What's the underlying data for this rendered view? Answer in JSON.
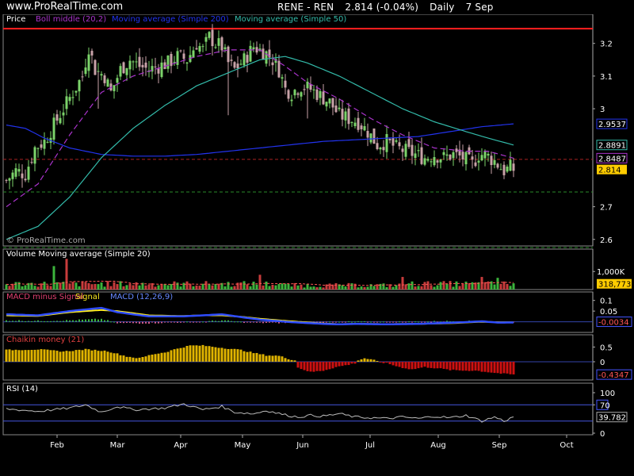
{
  "header": {
    "brand": "www.ProRealTime.com",
    "symbol": "RENE - REN",
    "last_change": "2.814 (-0.04%)",
    "period": "Daily",
    "date": "7 Sep"
  },
  "colors": {
    "up": "#7bd36a",
    "down": "#c8a2a8",
    "boll": "#aa33cc",
    "ma200": "#2233ee",
    "ma50": "#33bbaa",
    "resistance": "#ff2020",
    "support": "#2a8a2a",
    "volume_up": "#3cb43c",
    "volume_down": "#c83c3c",
    "vol_ma": "#ff5555",
    "macd": "#2e4cff",
    "signal": "#ffee22",
    "chaikin_pos": "#e0b400",
    "chaikin_neg": "#cc1111",
    "rsi": "#bbbbbb",
    "rsi_bands": "#4455dd",
    "last_price_bg": "#ffcc00"
  },
  "chart_data": [
    {
      "type": "candlestick",
      "title": "Price",
      "legend": [
        "Boll middle (20,2)",
        "Moving average (Simple 200)",
        "Moving average (Simple 50)"
      ],
      "y_ticks": [
        "3.2",
        "3.1",
        "3",
        "2.7",
        "2.6"
      ],
      "ylim": [
        2.58,
        3.26
      ],
      "watermark": "© ProRealTime.com",
      "x_months": [
        "Feb",
        "Mar",
        "Apr",
        "May",
        "Jun",
        "Jul",
        "Aug",
        "Sep",
        "Oct"
      ],
      "value_tags": [
        {
          "label": "2.9537",
          "value": 2.9537,
          "series": "ma200"
        },
        {
          "label": "2.8891",
          "value": 2.8891,
          "series": "ma50"
        },
        {
          "label": "2.8487",
          "value": 2.8487,
          "series": "boll"
        },
        {
          "label": "2.814",
          "value": 2.814,
          "series": "last"
        }
      ],
      "resistance": 3.245,
      "reference_levels": [
        2.845,
        2.745,
        2.575
      ],
      "close_anchors": [
        [
          0,
          2.78
        ],
        [
          3,
          2.81
        ],
        [
          6,
          2.8
        ],
        [
          9,
          2.88
        ],
        [
          12,
          2.9
        ],
        [
          15,
          2.95
        ],
        [
          18,
          3.0
        ],
        [
          21,
          3.05
        ],
        [
          24,
          3.1
        ],
        [
          26,
          3.19
        ],
        [
          28,
          3.12
        ],
        [
          31,
          3.1
        ],
        [
          33,
          3.05
        ],
        [
          36,
          3.12
        ],
        [
          39,
          3.15
        ],
        [
          42,
          3.13
        ],
        [
          45,
          3.12
        ],
        [
          48,
          3.13
        ],
        [
          51,
          3.14
        ],
        [
          54,
          3.16
        ],
        [
          57,
          3.15
        ],
        [
          60,
          3.2
        ],
        [
          62,
          3.18
        ],
        [
          64,
          3.22
        ],
        [
          66,
          3.2
        ],
        [
          68,
          3.19
        ],
        [
          70,
          3.14
        ],
        [
          72,
          3.12
        ],
        [
          75,
          3.15
        ],
        [
          78,
          3.19
        ],
        [
          80,
          3.18
        ],
        [
          82,
          3.17
        ],
        [
          84,
          3.15
        ],
        [
          86,
          3.12
        ],
        [
          88,
          3.06
        ],
        [
          90,
          3.05
        ],
        [
          93,
          3.07
        ],
        [
          96,
          3.06
        ],
        [
          99,
          3.04
        ],
        [
          102,
          3.02
        ],
        [
          105,
          2.98
        ],
        [
          108,
          2.97
        ],
        [
          111,
          2.96
        ],
        [
          114,
          2.93
        ],
        [
          117,
          2.89
        ],
        [
          120,
          2.9
        ],
        [
          123,
          2.88
        ],
        [
          126,
          2.87
        ],
        [
          129,
          2.86
        ],
        [
          132,
          2.85
        ],
        [
          135,
          2.86
        ],
        [
          138,
          2.85
        ],
        [
          141,
          2.86
        ],
        [
          144,
          2.85
        ],
        [
          147,
          2.83
        ],
        [
          149,
          2.86
        ],
        [
          151,
          2.86
        ],
        [
          154,
          2.84
        ],
        [
          157,
          2.81
        ],
        [
          159,
          2.82
        ],
        [
          160,
          2.814
        ]
      ],
      "ma50_anchors": [
        [
          0,
          2.6
        ],
        [
          10,
          2.64
        ],
        [
          20,
          2.73
        ],
        [
          30,
          2.85
        ],
        [
          40,
          2.94
        ],
        [
          50,
          3.01
        ],
        [
          60,
          3.07
        ],
        [
          70,
          3.11
        ],
        [
          80,
          3.15
        ],
        [
          88,
          3.16
        ],
        [
          95,
          3.14
        ],
        [
          105,
          3.1
        ],
        [
          115,
          3.05
        ],
        [
          125,
          3.0
        ],
        [
          135,
          2.96
        ],
        [
          145,
          2.93
        ],
        [
          152,
          2.91
        ],
        [
          160,
          2.889
        ]
      ],
      "ma200_anchors": [
        [
          0,
          2.95
        ],
        [
          6,
          2.94
        ],
        [
          12,
          2.91
        ],
        [
          20,
          2.88
        ],
        [
          30,
          2.86
        ],
        [
          40,
          2.855
        ],
        [
          50,
          2.855
        ],
        [
          60,
          2.86
        ],
        [
          70,
          2.87
        ],
        [
          80,
          2.88
        ],
        [
          90,
          2.89
        ],
        [
          100,
          2.9
        ],
        [
          110,
          2.905
        ],
        [
          120,
          2.91
        ],
        [
          130,
          2.915
        ],
        [
          140,
          2.93
        ],
        [
          150,
          2.945
        ],
        [
          160,
          2.9537
        ]
      ],
      "boll_anchors": [
        [
          0,
          2.7
        ],
        [
          10,
          2.77
        ],
        [
          20,
          2.92
        ],
        [
          30,
          3.05
        ],
        [
          40,
          3.1
        ],
        [
          50,
          3.13
        ],
        [
          60,
          3.16
        ],
        [
          70,
          3.18
        ],
        [
          80,
          3.18
        ],
        [
          88,
          3.13
        ],
        [
          95,
          3.08
        ],
        [
          105,
          3.03
        ],
        [
          115,
          2.97
        ],
        [
          125,
          2.92
        ],
        [
          135,
          2.88
        ],
        [
          145,
          2.87
        ],
        [
          152,
          2.87
        ],
        [
          160,
          2.8487
        ]
      ]
    },
    {
      "type": "bar",
      "title": "Volume Moving average (Simple 20)",
      "y_tick": "1,000K",
      "last_value_label": "318,773",
      "last_value": 318773,
      "spikes": [
        {
          "i": 15,
          "v": 1300000
        },
        {
          "i": 19,
          "v": 1700000
        },
        {
          "i": 80,
          "v": 820000
        },
        {
          "i": 125,
          "v": 700000
        },
        {
          "i": 150,
          "v": 700000
        },
        {
          "i": 155,
          "v": 650000
        }
      ]
    },
    {
      "type": "line",
      "title": "MACD minus Signal",
      "series_label": "Signal",
      "secondary_label": "MACD (12,26,9)",
      "y_ticks": [
        "0.1",
        "0.05"
      ],
      "last_value_label": "-0.0034",
      "ylim": [
        -0.05,
        0.11
      ],
      "macd_anchors": [
        [
          0,
          0.035
        ],
        [
          10,
          0.03
        ],
        [
          20,
          0.05
        ],
        [
          30,
          0.065
        ],
        [
          35,
          0.045
        ],
        [
          45,
          0.025
        ],
        [
          55,
          0.025
        ],
        [
          62,
          0.03
        ],
        [
          68,
          0.035
        ],
        [
          75,
          0.02
        ],
        [
          80,
          0.01
        ],
        [
          90,
          -0.002
        ],
        [
          100,
          -0.01
        ],
        [
          105,
          -0.012
        ],
        [
          110,
          -0.01
        ],
        [
          120,
          -0.012
        ],
        [
          130,
          -0.01
        ],
        [
          140,
          -0.005
        ],
        [
          150,
          0.002
        ],
        [
          155,
          -0.004
        ],
        [
          160,
          -0.0034
        ]
      ],
      "signal_anchors": [
        [
          0,
          0.03
        ],
        [
          10,
          0.027
        ],
        [
          20,
          0.045
        ],
        [
          30,
          0.055
        ],
        [
          35,
          0.05
        ],
        [
          45,
          0.03
        ],
        [
          55,
          0.027
        ],
        [
          62,
          0.03
        ],
        [
          68,
          0.03
        ],
        [
          75,
          0.022
        ],
        [
          80,
          0.014
        ],
        [
          90,
          0.002
        ],
        [
          100,
          -0.008
        ],
        [
          105,
          -0.011
        ],
        [
          110,
          -0.01
        ],
        [
          120,
          -0.011
        ],
        [
          130,
          -0.01
        ],
        [
          140,
          -0.007
        ],
        [
          150,
          0.0
        ],
        [
          155,
          -0.002
        ],
        [
          160,
          -0.003
        ]
      ]
    },
    {
      "type": "bar",
      "title": "Chaikin money (21)",
      "y_ticks": [
        "0.5",
        "0"
      ],
      "last_value_label": "-0.4347",
      "ylim": [
        -0.62,
        0.7
      ],
      "anchors": [
        [
          0,
          0.4
        ],
        [
          10,
          0.42
        ],
        [
          18,
          0.35
        ],
        [
          25,
          0.42
        ],
        [
          32,
          0.36
        ],
        [
          38,
          0.18
        ],
        [
          42,
          0.12
        ],
        [
          46,
          0.25
        ],
        [
          50,
          0.32
        ],
        [
          54,
          0.45
        ],
        [
          58,
          0.55
        ],
        [
          62,
          0.55
        ],
        [
          66,
          0.5
        ],
        [
          70,
          0.45
        ],
        [
          74,
          0.4
        ],
        [
          78,
          0.3
        ],
        [
          82,
          0.22
        ],
        [
          86,
          0.2
        ],
        [
          89,
          0.1
        ],
        [
          91,
          0.05
        ],
        [
          92,
          -0.2
        ],
        [
          96,
          -0.35
        ],
        [
          100,
          -0.3
        ],
        [
          104,
          -0.18
        ],
        [
          108,
          -0.1
        ],
        [
          110,
          -0.05
        ],
        [
          111,
          0.05
        ],
        [
          113,
          0.12
        ],
        [
          116,
          0.05
        ],
        [
          118,
          -0.02
        ],
        [
          120,
          -0.05
        ],
        [
          124,
          -0.18
        ],
        [
          128,
          -0.26
        ],
        [
          132,
          -0.18
        ],
        [
          136,
          -0.22
        ],
        [
          140,
          -0.28
        ],
        [
          144,
          -0.3
        ],
        [
          148,
          -0.3
        ],
        [
          152,
          -0.35
        ],
        [
          156,
          -0.4
        ],
        [
          160,
          -0.4347
        ]
      ]
    },
    {
      "type": "line",
      "title": "RSI (14)",
      "y_ticks": [
        "100",
        "70",
        "0"
      ],
      "last_value_label": "39.782",
      "ylim": [
        0,
        100
      ],
      "bands": [
        70,
        30
      ],
      "anchors": [
        [
          0,
          60
        ],
        [
          10,
          54
        ],
        [
          20,
          62
        ],
        [
          25,
          70
        ],
        [
          30,
          52
        ],
        [
          35,
          66
        ],
        [
          40,
          58
        ],
        [
          50,
          62
        ],
        [
          56,
          72
        ],
        [
          62,
          58
        ],
        [
          68,
          66
        ],
        [
          72,
          52
        ],
        [
          78,
          48
        ],
        [
          82,
          56
        ],
        [
          88,
          45
        ],
        [
          92,
          40
        ],
        [
          96,
          44
        ],
        [
          100,
          42
        ],
        [
          105,
          48
        ],
        [
          110,
          40
        ],
        [
          115,
          38
        ],
        [
          120,
          36
        ],
        [
          125,
          40
        ],
        [
          130,
          36
        ],
        [
          135,
          42
        ],
        [
          140,
          38
        ],
        [
          145,
          44
        ],
        [
          150,
          30
        ],
        [
          154,
          40
        ],
        [
          157,
          30
        ],
        [
          160,
          39.782
        ]
      ]
    }
  ]
}
